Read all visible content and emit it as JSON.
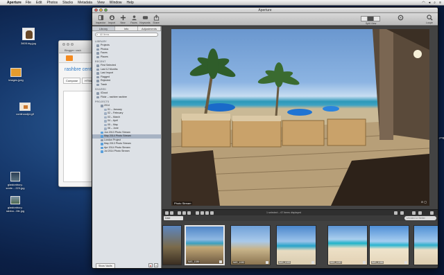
{
  "menubar": {
    "app": "Aperture",
    "items": [
      "File",
      "Edit",
      "Photos",
      "Stacks",
      "Metadata",
      "View",
      "Window",
      "Help"
    ]
  },
  "desktop": {
    "icons": [
      "3605.big.jpg",
      "images.jpeg",
      "conlinoodjd.gif",
      "glastonbury-smile....223.jpg",
      "glastonbury-rainbo...0fe.jpg"
    ]
  },
  "browser_window": {
    "tab_text": "Blogger: rash",
    "blog_title": "rashbre centra",
    "tab_compose": "Compose",
    "tab_html": "HTML"
  },
  "aperture": {
    "window_title": "Aperture",
    "toolbar": {
      "inspector": "Inspector",
      "import": "Import",
      "new": "New",
      "faces": "Faces",
      "keywords": "Keywords",
      "share": "Share",
      "split_view": "Split View",
      "loupe": "Loupe"
    },
    "sidebar": {
      "tabs": [
        "Library",
        "Info",
        "Adjustments"
      ],
      "search_placeholder": "All Items",
      "sections": {
        "library": "LIBRARY",
        "recent": "RECENT",
        "shared": "SHARED",
        "projects": "PROJECTS"
      },
      "library_items": [
        "Projects",
        "Photos",
        "Faces",
        "Places"
      ],
      "recent_items": [
        "First Selected",
        "Last 12 Months",
        "Last Import",
        "Flagged",
        "Rejected",
        "Trash"
      ],
      "shared_items": [
        "iCloud",
        "Flickr – rashbre rashbre"
      ],
      "projects": [
        {
          "label": "2014",
          "level": 0
        },
        {
          "label": "01 – January",
          "level": 1
        },
        {
          "label": "02 – February",
          "level": 1
        },
        {
          "label": "03 – March",
          "level": 1
        },
        {
          "label": "04 – April",
          "level": 1
        },
        {
          "label": "05 – May",
          "level": 1
        },
        {
          "label": "06 – June",
          "level": 1
        },
        {
          "label": "Jun 2013 Photo Stream",
          "level": 0
        },
        {
          "label": "May 2014 Photo Stream",
          "level": 0,
          "selected": true
        },
        {
          "label": "London Project",
          "level": 0
        },
        {
          "label": "May 2013 Photo Stream",
          "level": 0
        },
        {
          "label": "Apr 2014 Photo Stream",
          "level": 0
        },
        {
          "label": "Jul 2014 Photo Stream",
          "level": 0
        }
      ],
      "show_vaults": "Show Vaults"
    },
    "viewer": {
      "photo_label": "Photo Stream"
    },
    "browser_bar": {
      "count_text": "1 selected – 67 items displayed",
      "sort_value": "Date",
      "search_placeholder": "Unrated or Better"
    },
    "filmstrip": [
      {
        "name": "",
        "selected": false
      },
      {
        "name": "IMG_1089",
        "selected": true
      },
      {
        "name": "IMG_1082",
        "selected": false
      },
      {
        "name": "IMG_1083",
        "selected": false
      },
      {
        "name": "IMG_1087",
        "selected": false
      },
      {
        "name": "IMG_1086",
        "selected": false
      },
      {
        "name": "",
        "selected": false
      }
    ]
  },
  "colors": {
    "sidebar_bg": "#dde1e6",
    "selection": "#a7b3c4",
    "viewer_bg": "#434343",
    "desktop": "#173a6e"
  }
}
